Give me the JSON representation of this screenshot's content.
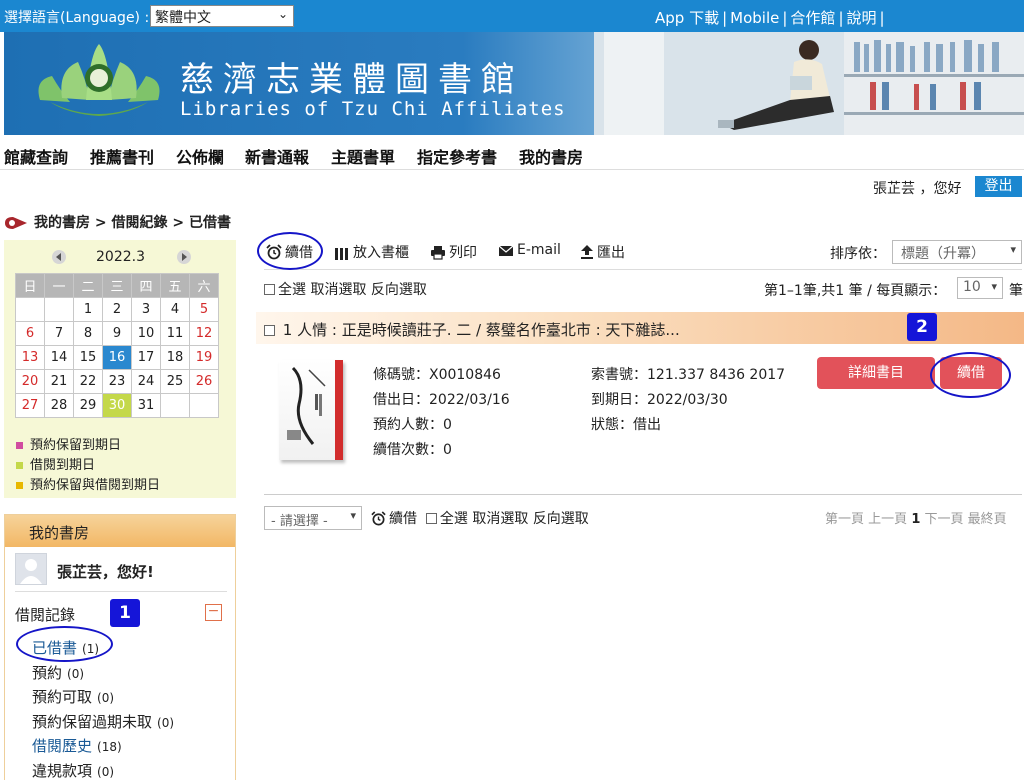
{
  "topbar": {
    "language_label": "選擇語言(Language) :",
    "language_value": "繁體中文",
    "links": [
      "App 下載",
      "Mobile",
      "合作館",
      "說明"
    ]
  },
  "banner": {
    "title_cn": "慈濟志業體圖書館",
    "title_en": "Libraries of Tzu Chi Affiliates"
  },
  "nav": [
    "館藏查詢",
    "推薦書刊",
    "公佈欄",
    "新書通報",
    "主題書單",
    "指定參考書",
    "我的書房"
  ],
  "user": {
    "greeting": "張芷芸 ，您好",
    "logout": "登出"
  },
  "breadcrumb": "我的書房 > 借閱紀錄 > 已借書",
  "calendar": {
    "title": "2022.3",
    "weekdays": [
      "日",
      "一",
      "二",
      "三",
      "四",
      "五",
      "六"
    ],
    "weeks": [
      [
        "",
        "",
        "1",
        "2",
        "3",
        "4",
        "5"
      ],
      [
        "6",
        "7",
        "8",
        "9",
        "10",
        "11",
        "12"
      ],
      [
        "13",
        "14",
        "15",
        "16",
        "17",
        "18",
        "19"
      ],
      [
        "20",
        "21",
        "22",
        "23",
        "24",
        "25",
        "26"
      ],
      [
        "27",
        "28",
        "29",
        "30",
        "31",
        "",
        ""
      ]
    ],
    "today": "16",
    "due_date": "30",
    "legend": [
      {
        "label": "預約保留到期日",
        "color": "#d14da0"
      },
      {
        "label": "借閱到期日",
        "color": "#c4d84a"
      },
      {
        "label": "預約保留與借閱到期日",
        "color": "#e8b800"
      }
    ]
  },
  "study": {
    "title": "我的書房",
    "hello": "張芷芸，您好!",
    "loan_section": "借閱記錄",
    "items": [
      {
        "label": "已借書",
        "count": "(1)"
      },
      {
        "label": "預約",
        "count": "(0)"
      },
      {
        "label": "預約可取",
        "count": "(0)"
      },
      {
        "label": "預約保留過期未取",
        "count": "(0)"
      },
      {
        "label": "借閱歷史",
        "count": "(18)"
      },
      {
        "label": "違規款項",
        "count": "(0)"
      }
    ]
  },
  "badges": [
    "1",
    "2"
  ],
  "toolbar": {
    "renew": "續借",
    "shelf": "放入書櫃",
    "print": "列印",
    "email": "E-mail",
    "export": "匯出",
    "sort_label": "排序依：",
    "sort_value": "標題（升冪）"
  },
  "selection": {
    "select_all": "全選",
    "deselect": "取消選取",
    "invert": "反向選取"
  },
  "paging": {
    "count_text": "第1–1筆,共1 筆 /  每頁顯示：",
    "per_page": "10",
    "per_page_suffix": "筆"
  },
  "record": {
    "index": "1",
    "title": "人情 : 正是時候讀莊子. 二 / 蔡璧名作臺北市 : 天下雜誌...",
    "barcode": "條碼號：X0010846",
    "call_no": "索書號：121.337 8436 2017",
    "loan_date": "借出日：2022/03/16",
    "due_date": "到期日：2022/03/30",
    "reservations": "預約人數：0",
    "status": "狀態：借出",
    "renewals": "續借次數：0",
    "detail_button": "詳細書目",
    "renew_button": "續借"
  },
  "bottom": {
    "select_placeholder": "- 請選擇 -",
    "renew": "續借",
    "first": "第一頁",
    "prev": "上一頁",
    "page": "1",
    "next": "下一頁",
    "last": "最終頁"
  }
}
